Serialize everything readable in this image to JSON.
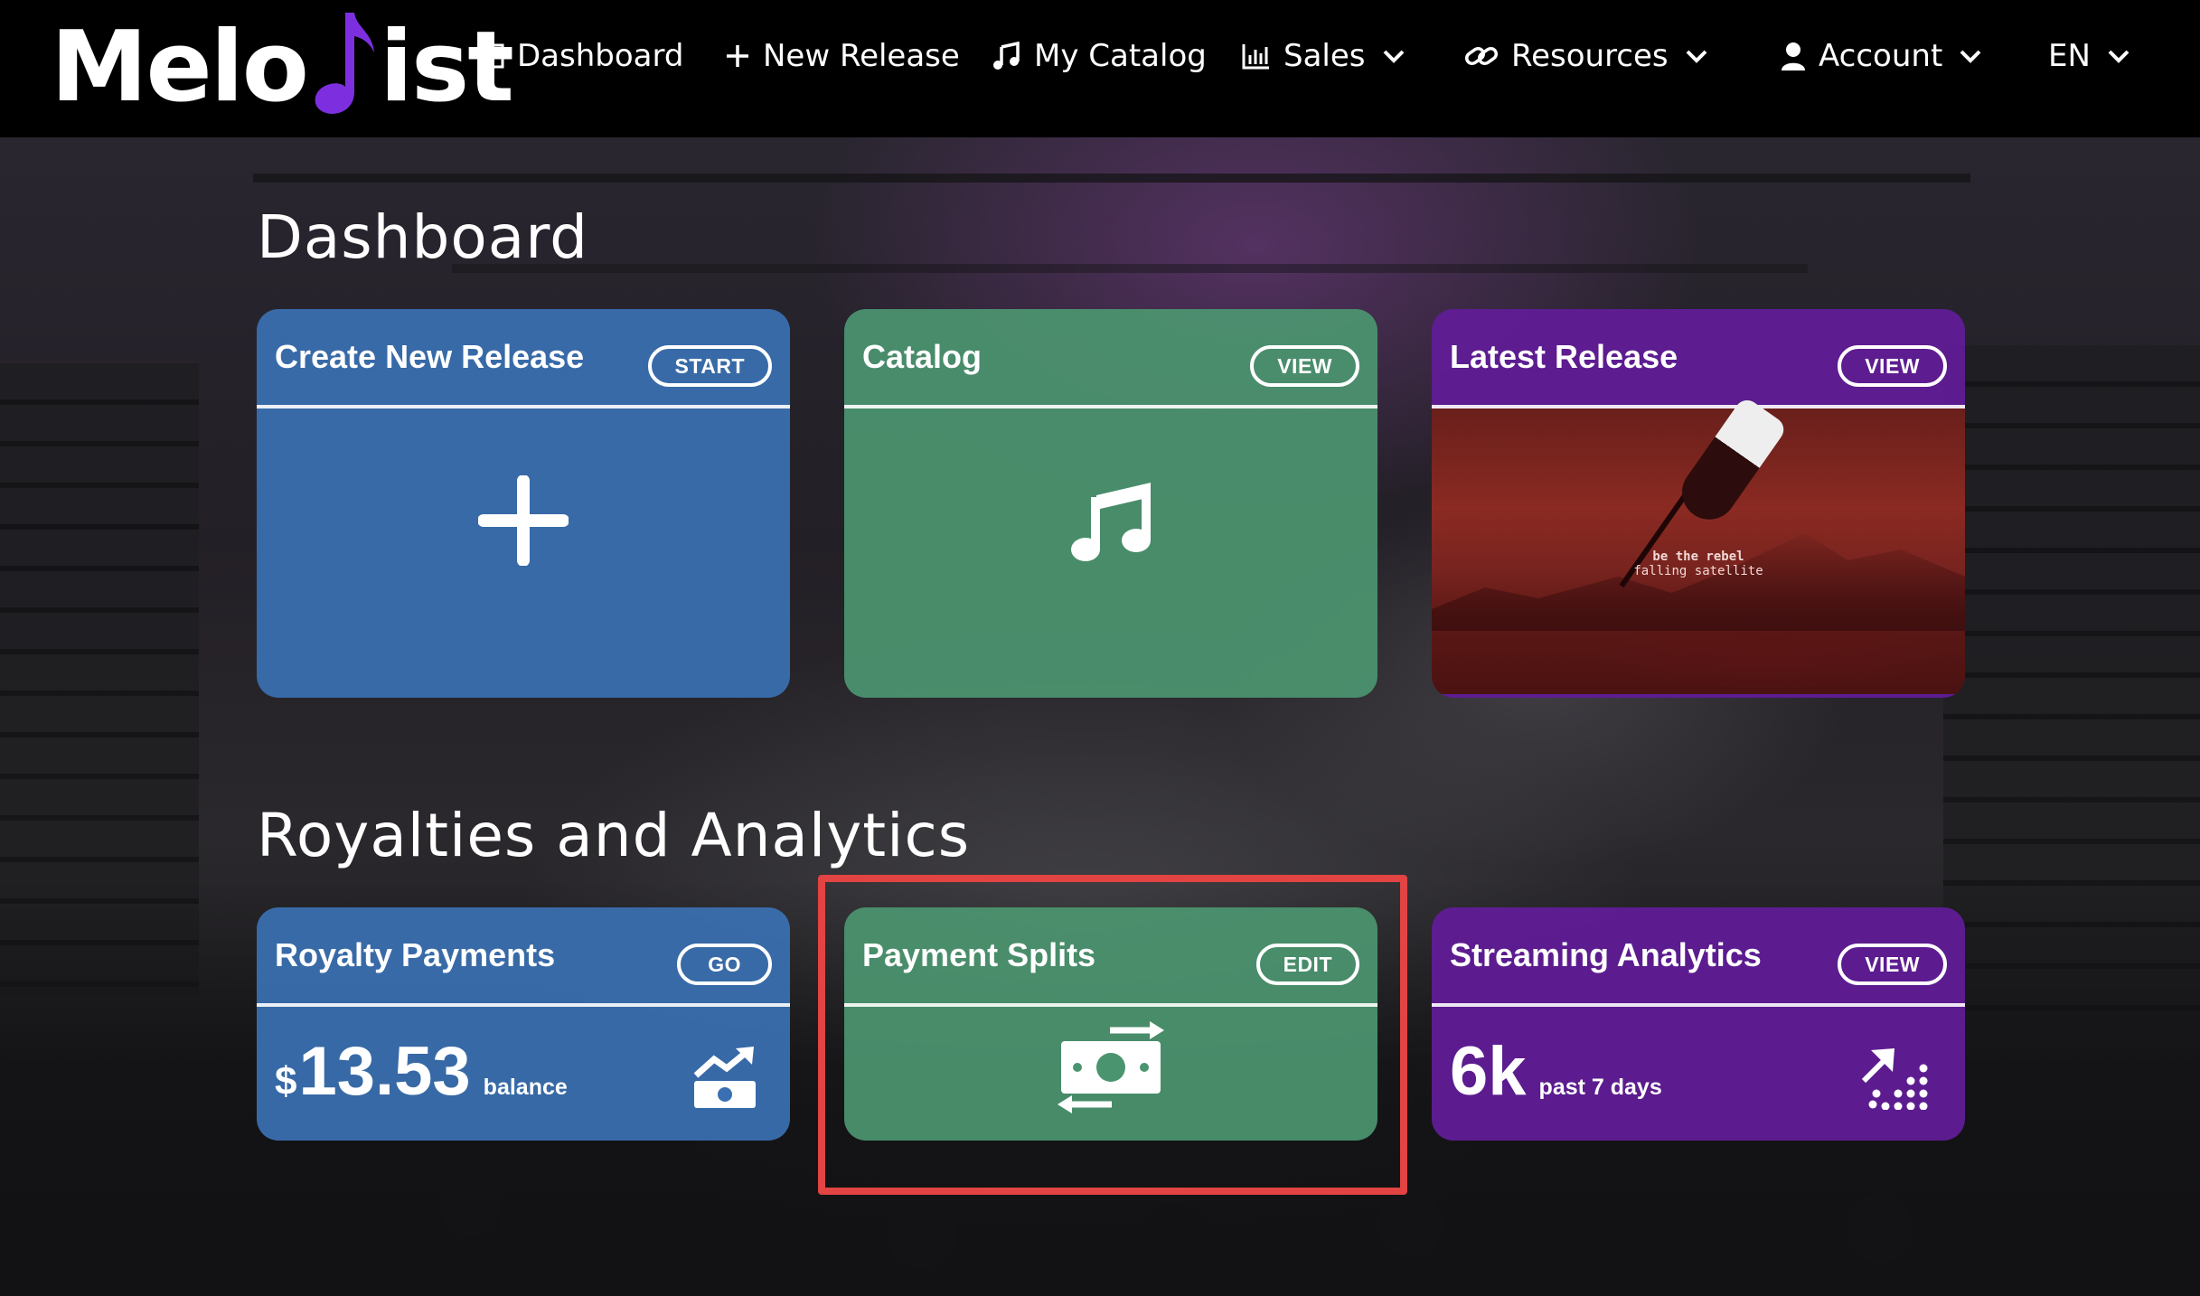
{
  "brand": {
    "logo_left": "Melo",
    "logo_right": "ist",
    "accent_color": "#7d2fe0"
  },
  "nav": {
    "dashboard": "Dashboard",
    "new_release": "New Release",
    "my_catalog": "My Catalog",
    "sales": "Sales",
    "resources": "Resources",
    "account": "Account",
    "language": "EN"
  },
  "dashboard": {
    "title": "Dashboard",
    "cards": {
      "create": {
        "title": "Create New Release",
        "action": "START",
        "icon": "plus-icon"
      },
      "catalog": {
        "title": "Catalog",
        "action": "VIEW",
        "icon": "music-note-icon"
      },
      "latest": {
        "title": "Latest Release",
        "action": "VIEW",
        "album_line1": "be the rebel",
        "album_line2": "falling satellite"
      }
    }
  },
  "royalties": {
    "title": "Royalties and Analytics",
    "cards": {
      "payments": {
        "title": "Royalty Payments",
        "action": "GO",
        "currency": "$",
        "amount": "13.53",
        "label": "balance",
        "icon": "money-growth-icon"
      },
      "splits": {
        "title": "Payment Splits",
        "action": "EDIT",
        "icon": "money-transfer-icon"
      },
      "streaming": {
        "title": "Streaming Analytics",
        "action": "VIEW",
        "value": "6k",
        "label": "past 7 days",
        "icon": "trend-up-dots-icon"
      }
    }
  },
  "colors": {
    "blue_card": "#3a70b2",
    "green_card": "#4b9470",
    "purple_card": "#601c96",
    "highlight": "#e24343"
  }
}
